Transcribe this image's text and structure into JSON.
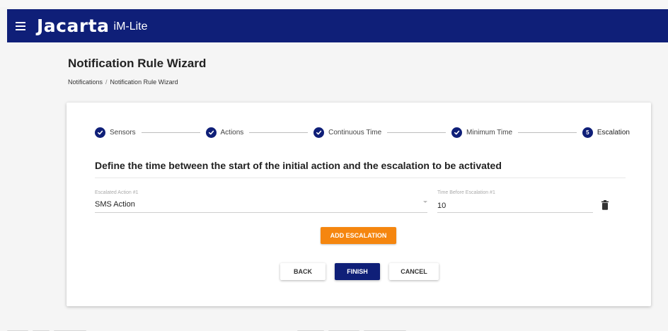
{
  "app": {
    "brand": "Jacarta",
    "product": "iM-Lite",
    "menu_icon": "hamburger-menu-icon"
  },
  "colors": {
    "primary": "#0f1f78",
    "accent": "#f5860f",
    "background": "#f5f5f5"
  },
  "page": {
    "title": "Notification Rule Wizard",
    "breadcrumb": [
      "Notifications",
      "Notification Rule Wizard"
    ],
    "breadcrumb_separator": "/"
  },
  "stepper": {
    "steps": [
      {
        "label": "Sensors",
        "state": "completed",
        "icon": "check-circle-icon"
      },
      {
        "label": "Actions",
        "state": "completed",
        "icon": "check-circle-icon"
      },
      {
        "label": "Continuous Time",
        "state": "completed",
        "icon": "check-circle-icon"
      },
      {
        "label": "Minimum Time",
        "state": "completed",
        "icon": "check-circle-icon"
      },
      {
        "label": "Escalation",
        "state": "active",
        "number": "5"
      }
    ]
  },
  "form": {
    "heading": "Define the time between the start of the initial action and the escalation to be activated",
    "escalated_action_label": "Escalated Action #1",
    "escalated_action_value": "SMS Action",
    "time_before_label": "Time Before Escalation #1",
    "time_before_value": "10",
    "delete_icon": "trash-icon"
  },
  "buttons": {
    "add_escalation": "ADD ESCALATION",
    "back": "BACK",
    "finish": "FINISH",
    "cancel": "CANCEL"
  }
}
